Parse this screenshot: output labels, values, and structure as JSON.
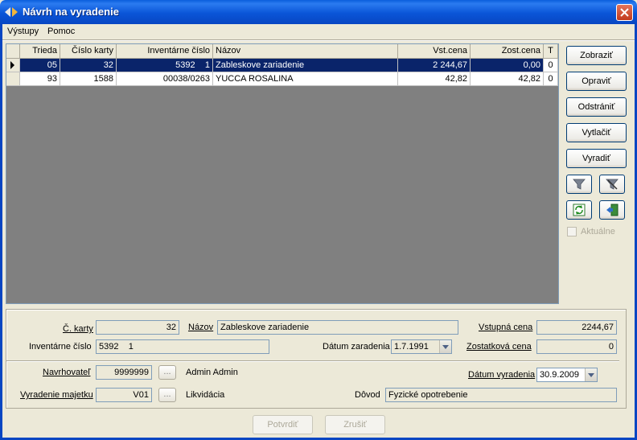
{
  "window": {
    "title": "Návrh na vyradenie"
  },
  "menu": [
    "Výstupy",
    "Pomoc"
  ],
  "grid": {
    "columns": [
      "Trieda",
      "Číslo karty",
      "Inventárne číslo",
      "Názov",
      "Vst.cena",
      "Zost.cena",
      "T"
    ],
    "rows": [
      {
        "trieda": "05",
        "cislo_karty": "32",
        "inv_cislo": "5392    1",
        "nazov": "Zableskove zariadenie",
        "vst_cena": "2 244,67",
        "zost_cena": "0,00",
        "t": "0",
        "selected": true
      },
      {
        "trieda": "93",
        "cislo_karty": "1588",
        "inv_cislo": "00038/0263",
        "nazov": "YUCCA ROSALINA",
        "vst_cena": "42,82",
        "zost_cena": "42,82",
        "t": "0",
        "selected": false
      }
    ]
  },
  "side_buttons": {
    "zobrazit": "Zobraziť",
    "opravit": "Opraviť",
    "odstranit": "Odstrániť",
    "vytlacit": "Vytlačiť",
    "vyradit": "Vyradiť"
  },
  "aktualne_label": "Aktuálne",
  "detail": {
    "c_karty_label": "Č. karty",
    "c_karty": "32",
    "nazov_label": "Názov",
    "nazov": "Zableskove zariadenie",
    "vstupna_cena_label": "Vstupná cena",
    "vstupna_cena": "2244,67",
    "inv_cislo_label": "Inventárne číslo",
    "inv_cislo": "5392    1",
    "datum_zaradenia_label": "Dátum zaradenia",
    "datum_zaradenia": "1.7.1991",
    "zostatkova_cena_label": "Zostatková cena",
    "zostatkova_cena": "0",
    "navrhovatel_label": "Navrhovateľ",
    "navrhovatel_kod": "9999999",
    "navrhovatel_meno": "Admin Admin",
    "datum_vyradenia_label": "Dátum vyradenia",
    "datum_vyradenia": "30.9.2009",
    "vyradenie_label": "Vyradenie majetku",
    "vyradenie_kod": "V01",
    "vyradenie_nazov": "Likvidácia",
    "dovod_label": "Dôvod",
    "dovod": "Fyzické opotrebenie",
    "dots": "..."
  },
  "bottom_buttons": {
    "potvrdit": "Potvrdiť",
    "zrusit": "Zrušiť"
  }
}
